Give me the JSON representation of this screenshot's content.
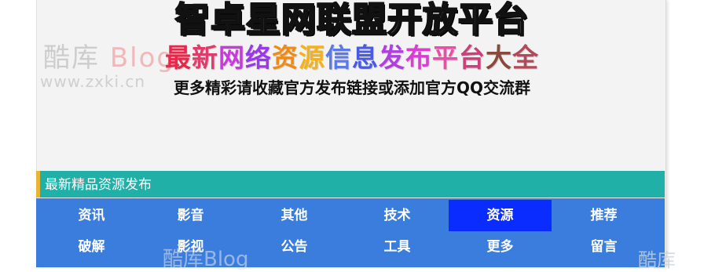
{
  "header": {
    "title": "智卓星网联盟开放平台",
    "subtitle_chars": [
      {
        "char": "最",
        "color": "#e8274b"
      },
      {
        "char": "新",
        "color": "#e23a6a"
      },
      {
        "char": "网",
        "color": "#c63bd9"
      },
      {
        "char": "络",
        "color": "#9b38e8"
      },
      {
        "char": "资",
        "color": "#f08a16"
      },
      {
        "char": "源",
        "color": "#f3b21b"
      },
      {
        "char": "信",
        "color": "#5a7ae6"
      },
      {
        "char": "息",
        "color": "#4a5be0"
      },
      {
        "char": "发",
        "color": "#b13fe0"
      },
      {
        "char": "布",
        "color": "#d540cf"
      },
      {
        "char": "平",
        "color": "#ee4aa8"
      },
      {
        "char": "台",
        "color": "#cc3f7a"
      },
      {
        "char": "大",
        "color": "#8a4a3a"
      },
      {
        "char": "全",
        "color": "#b24a5a"
      }
    ],
    "note": "更多精彩请收藏官方发布链接或添加官方QQ交流群"
  },
  "watermark": {
    "logo_text": "酷库",
    "logo_blog": "Blog",
    "url": "www.zxki.cn",
    "bottom_text": "酷库Blog",
    "corner_text": "酷库"
  },
  "section": {
    "title": "最新精品资源发布"
  },
  "nav": {
    "items": [
      {
        "label": "资讯",
        "active": false
      },
      {
        "label": "影音",
        "active": false
      },
      {
        "label": "其他",
        "active": false
      },
      {
        "label": "技术",
        "active": false
      },
      {
        "label": "资源",
        "active": true
      },
      {
        "label": "推荐",
        "active": false
      },
      {
        "label": "破解",
        "active": false
      },
      {
        "label": "影视",
        "active": false
      },
      {
        "label": "公告",
        "active": false
      },
      {
        "label": "工具",
        "active": false
      },
      {
        "label": "更多",
        "active": false
      },
      {
        "label": "留言",
        "active": false
      }
    ]
  },
  "colors": {
    "section_bg": "#20b0a8",
    "section_accent": "#e8b533",
    "nav_bg": "#3a7ddc",
    "nav_active": "#0a2cff"
  }
}
